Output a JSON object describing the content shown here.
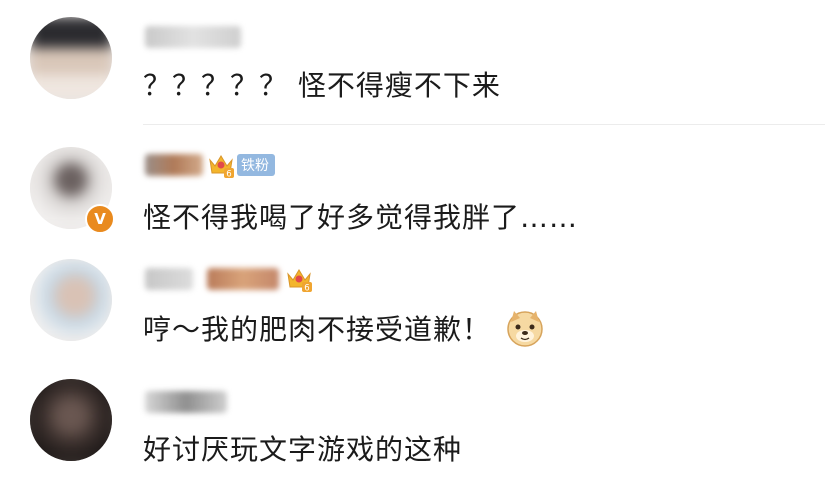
{
  "comments": [
    {
      "text": "？？？？？ 怪不得瘦不下来",
      "badges": {}
    },
    {
      "text": "怪不得我喝了好多觉得我胖了……",
      "badges": {
        "fan": "铁粉",
        "crown_level": "6",
        "verified": "V"
      }
    },
    {
      "text": "哼～我的肥肉不接受道歉！",
      "badges": {
        "crown_level": "6"
      },
      "emoji": "doge-emoji"
    },
    {
      "text": "好讨厌玩文字游戏的这种",
      "badges": {}
    }
  ],
  "colors": {
    "text": "#1b1b1b",
    "fan_badge": "#93b8e0",
    "verified_badge": "#e98a1e",
    "crown": "#f3b52c",
    "divider": "#ececec"
  }
}
